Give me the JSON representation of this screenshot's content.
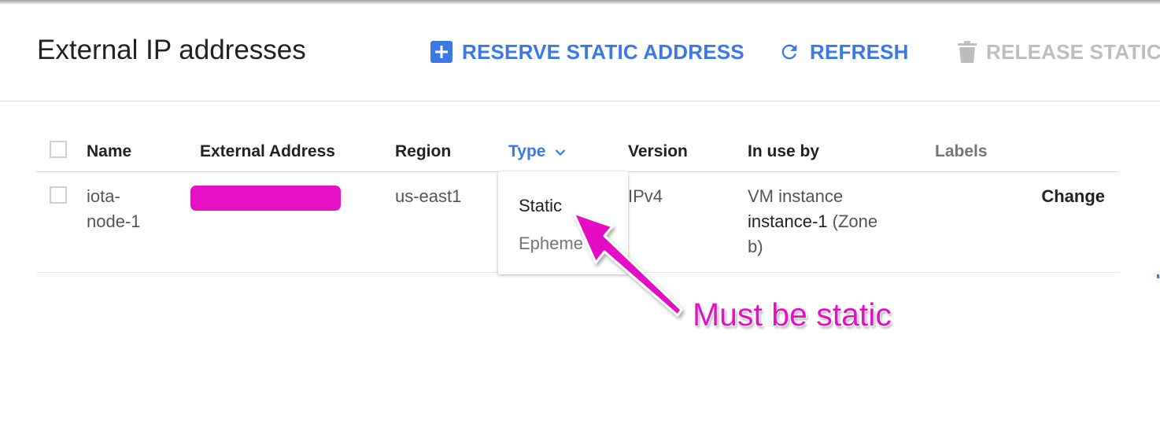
{
  "header": {
    "title": "External IP addresses",
    "actions": {
      "reserve": {
        "label": "RESERVE STATIC ADDRESS",
        "icon": "add-box-icon",
        "color": "#3b78e7"
      },
      "refresh": {
        "label": "REFRESH",
        "icon": "refresh-icon",
        "color": "#3b78e7"
      },
      "release": {
        "label": "RELEASE STATIC A",
        "icon": "trash-icon",
        "color": "#bdbdbd",
        "enabled": false
      }
    }
  },
  "table": {
    "columns": {
      "name": "Name",
      "external_address": "External Address",
      "region": "Region",
      "type": "Type",
      "version": "Version",
      "in_use_by": "In use by",
      "labels": "Labels"
    },
    "sorted_column": "Type",
    "rows": [
      {
        "name_line1": "iota-",
        "name_line2": "node-1",
        "external_address_redacted": true,
        "region": "us-east1",
        "version": "IPv4",
        "in_use_by_line1": "VM instance",
        "in_use_by_instance": "instance-1",
        "in_use_by_zone1": " (Zone",
        "in_use_by_zone2": "b)",
        "action": "Change"
      }
    ]
  },
  "type_dropdown": {
    "options": [
      "Static",
      "Epheme"
    ],
    "selected": "Static"
  },
  "annotation": {
    "text": "Must be static",
    "color": "#e410c4"
  }
}
